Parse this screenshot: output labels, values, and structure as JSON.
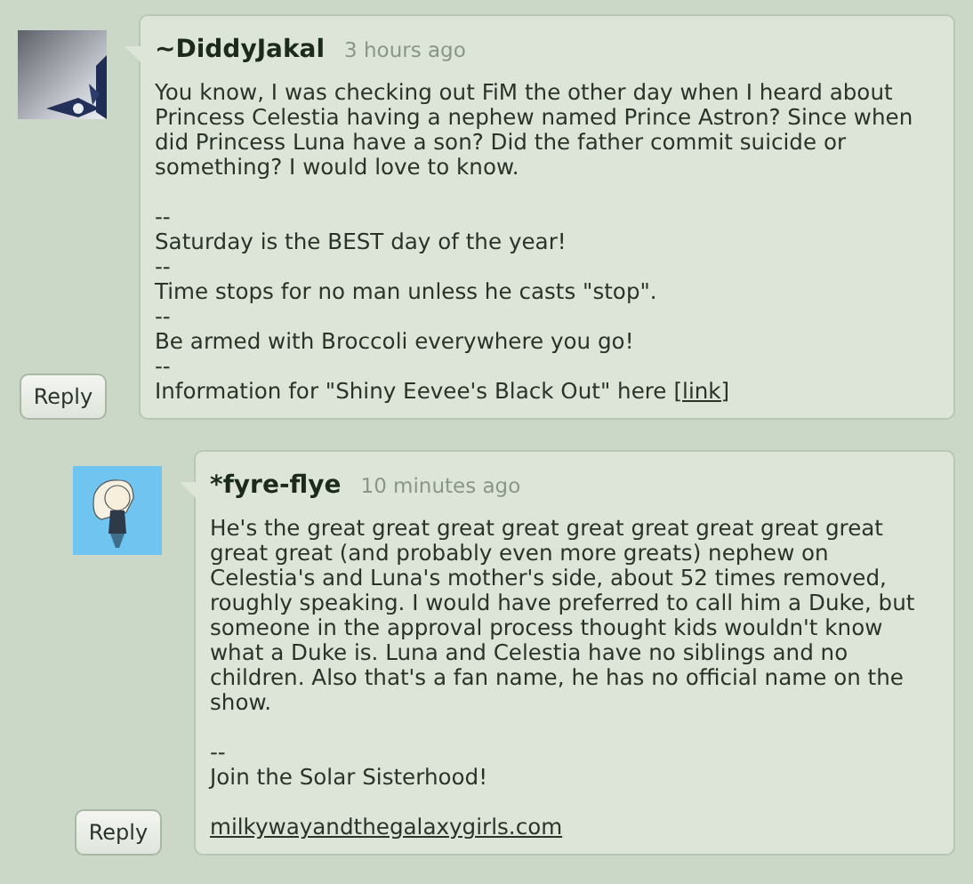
{
  "comments": [
    {
      "username": "~DiddyJakal",
      "time": "3 hours ago",
      "body": "You know, I was checking out FiM the other day when I heard about Princess Celestia having a nephew named Prince Astron? Since when did Princess Luna have a son? Did the father commit suicide or something? I would love to know.",
      "signature": [
        {
          "kind": "divider",
          "text": "--"
        },
        {
          "kind": "text",
          "text": "Saturday is the BEST day of the year!"
        },
        {
          "kind": "divider",
          "text": "--"
        },
        {
          "kind": "text",
          "text": "Time stops for no man unless he casts \"stop\"."
        },
        {
          "kind": "divider",
          "text": "--"
        },
        {
          "kind": "text",
          "text": "Be armed with Broccoli everywhere you go!"
        },
        {
          "kind": "divider",
          "text": "--"
        },
        {
          "kind": "text_link",
          "text": "Information for \"Shiny Eevee's Black Out\" here",
          "link": "[link]"
        }
      ],
      "reply_button": "Reply",
      "children": [
        {
          "username": "*fyre-flye",
          "time": "10 minutes ago",
          "avatar": {
            "kind": "figure"
          },
          "body": "He's the great great great great great great great great great great great (and probably even more greats) nephew on Celestia's and Luna's mother's side, about 52 times removed, roughly speaking. I would have preferred to call him a Duke, but someone in the approval process thought kids wouldn't know what a Duke is. Luna and Celestia have no siblings and no children. Also that's a fan name, he has no official name on the show.",
          "signature": [
            {
              "kind": "divider",
              "text": "--"
            },
            {
              "kind": "text",
              "text": "Join the Solar Sisterhood!"
            },
            {
              "kind": "link",
              "text": "milkywayandthegalaxygirls.com"
            }
          ],
          "reply_button": "Reply"
        }
      ]
    }
  ]
}
